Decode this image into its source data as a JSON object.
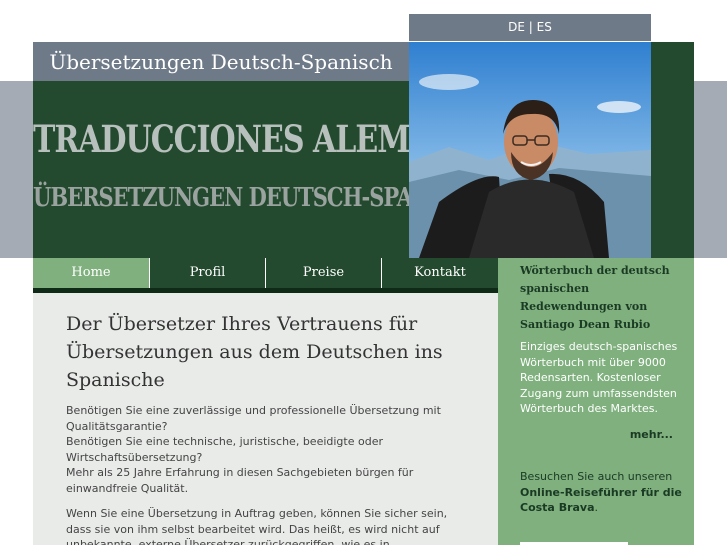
{
  "language_switch": {
    "de": "DE",
    "separator": "|",
    "es": "ES"
  },
  "header": {
    "title": "Übersetzungen Deutsch-Spanisch",
    "banner_line1": "TRADUCCIONES ALEMÁN-ESPAÑOL",
    "banner_line2": "ÜBERSETZUNGEN DEUTSCH-SPANISCH"
  },
  "nav": {
    "items": [
      {
        "label": "Home",
        "active": true
      },
      {
        "label": "Profil",
        "active": false
      },
      {
        "label": "Preise",
        "active": false
      },
      {
        "label": "Kontakt",
        "active": false
      }
    ]
  },
  "main": {
    "heading": "Der Übersetzer Ihres Vertrauens für Übersetzungen aus dem Deutschen ins Spanische",
    "paragraph1_lines": [
      "Benötigen Sie eine zuverlässige und professionelle Übersetzung mit Qualitätsgarantie?",
      "Benötigen Sie eine technische, juristische, beeidigte oder Wirtschaftsübersetzung?",
      "Mehr als 25 Jahre Erfahrung in diesen Sachgebieten bürgen für einwandfreie Qualität."
    ],
    "paragraph2": "Wenn Sie eine Übersetzung in Auftrag geben, können Sie sicher sein, dass sie von ihm selbst bearbeitet wird. Das heißt, es wird nicht auf unbekannte, externe Übersetzer zurückgegriffen, wie es in Übersetzungsagenturen üblich ist, die"
  },
  "sidebar": {
    "title": "Wörterbuch der deutsch spanischen Redewendungen von Santiago Dean Rubio",
    "text": "Einziges deutsch-spanisches Wörterbuch mit über 9000 Redensarten. Kostenloser Zugang zum umfassendsten Wörterbuch des Marktes.",
    "more": "mehr...",
    "visit_prefix": "Besuchen Sie auch unseren",
    "visit_link": "Online-Reiseführer für die Costa Brava",
    "visit_suffix": "."
  },
  "colors": {
    "dark_green": "#234a2e",
    "light_green": "#7fb07e",
    "slate": "#6f7a89",
    "gray_band": "#a4abb5",
    "content_bg": "#e9ebe9"
  }
}
